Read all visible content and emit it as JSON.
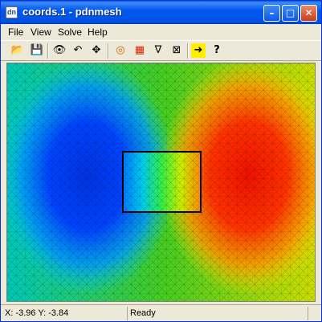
{
  "window": {
    "title": "coords.1 - pdnmesh",
    "app_icon_text": "dn",
    "controls": {
      "minimize": "–",
      "maximize": "□",
      "close": "✕"
    }
  },
  "menu": {
    "items": [
      "File",
      "View",
      "Solve",
      "Help"
    ]
  },
  "toolbar": {
    "tools": [
      {
        "name": "open-folder-icon",
        "glyph": "📂"
      },
      {
        "name": "save-icon",
        "glyph": "💾"
      },
      {
        "name": "eye-icon",
        "glyph": "👁"
      },
      {
        "name": "rotate-icon",
        "glyph": "↶"
      },
      {
        "name": "move-icon",
        "glyph": "✥"
      },
      {
        "name": "contour-icon",
        "glyph": "◎"
      },
      {
        "name": "color-map-icon",
        "glyph": "▦"
      },
      {
        "name": "gradient-icon",
        "glyph": "∇"
      },
      {
        "name": "mesh-icon",
        "glyph": "⊠"
      },
      {
        "name": "arrow-right-icon",
        "glyph": "➜"
      },
      {
        "name": "help-icon",
        "glyph": "?"
      }
    ]
  },
  "status": {
    "coords": "X: -3.96 Y: -3.84",
    "state": "Ready"
  },
  "plot": {
    "low_color": "#0033e0",
    "high_color": "#ee1200"
  }
}
